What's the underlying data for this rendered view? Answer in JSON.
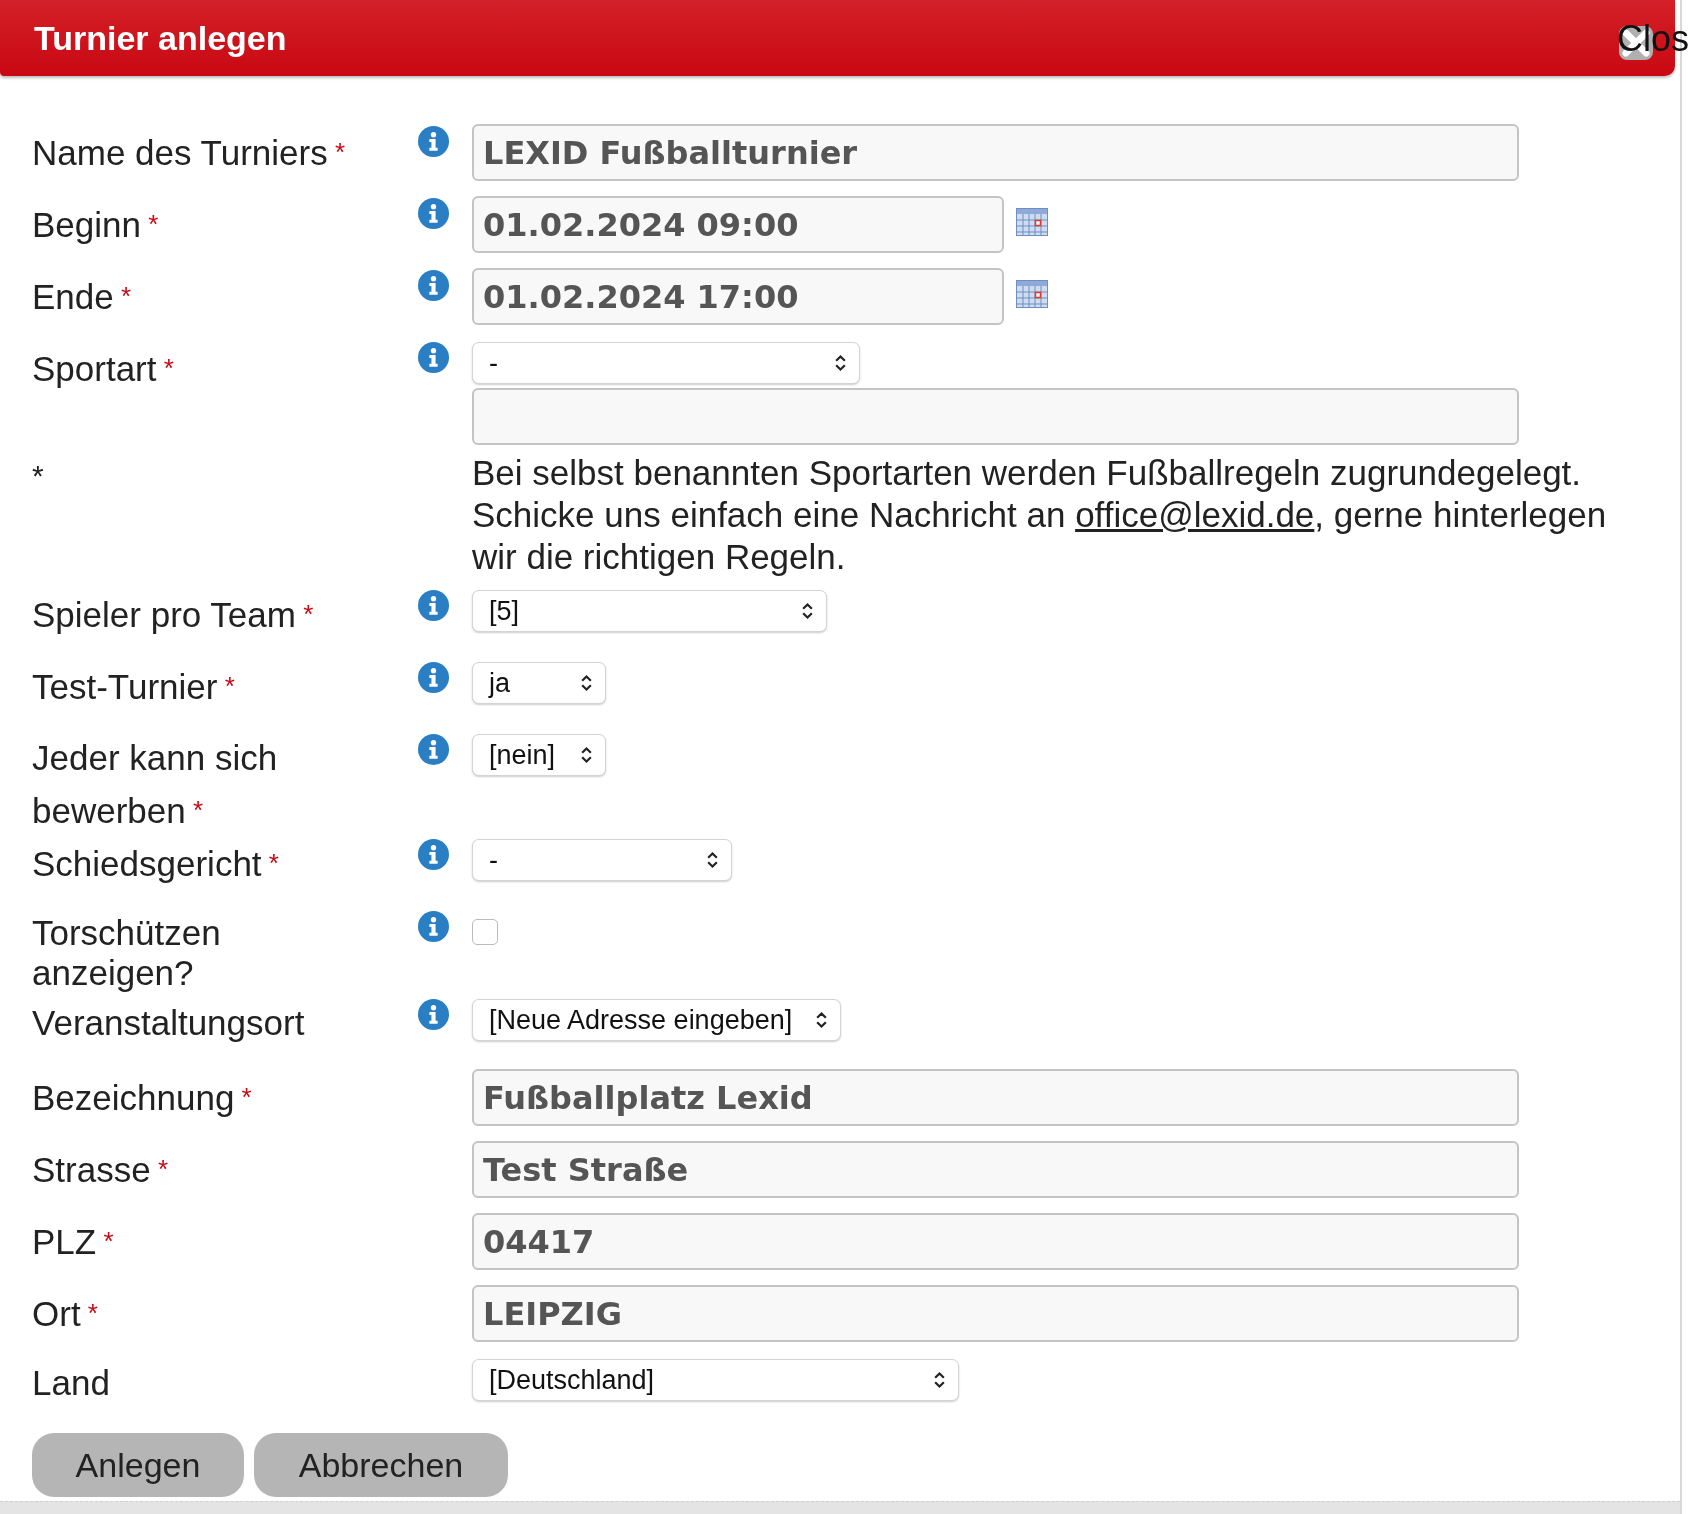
{
  "dialog": {
    "title": "Turnier anlegen",
    "close_button": "Clos"
  },
  "fields": [
    {
      "kind": "text",
      "label": "Name des Turniers",
      "required": true,
      "info": true,
      "value": "LEXID Fußballturnier"
    },
    {
      "kind": "date",
      "label": "Beginn",
      "required": true,
      "info": true,
      "value": "01.02.2024 09:00"
    },
    {
      "kind": "date",
      "label": "Ende",
      "required": true,
      "info": true,
      "value": "01.02.2024 17:00"
    },
    {
      "kind": "select_input",
      "label": "Sportart",
      "required": true,
      "info": true,
      "value": "-"
    },
    {
      "kind": "note",
      "label": "*",
      "required": false,
      "info": false,
      "text_before": "Bei selbst benannten Sportarten werden Fußballregeln zugrundegelegt. Schicke uns einfach eine Nachricht an ",
      "link": "office@lexid.de",
      "text_after": ", gerne hinterlegen wir die richtigen Regeln."
    },
    {
      "kind": "select",
      "label": "Spieler pro Team",
      "required": true,
      "info": true,
      "value": "[5]"
    },
    {
      "kind": "select",
      "label": "Test-Turnier",
      "required": true,
      "info": true,
      "value": "ja"
    },
    {
      "kind": "select",
      "label": "Jeder kann sich bewerben",
      "required": true,
      "info": true,
      "value": "[nein]"
    },
    {
      "kind": "select",
      "label": "Schiedsgericht",
      "required": true,
      "info": true,
      "value": "-"
    },
    {
      "kind": "checkbox",
      "label": "Torschützen anzeigen?",
      "required": false,
      "info": true,
      "checked": false
    },
    {
      "kind": "select",
      "label": "Veranstaltungsort",
      "required": false,
      "info": true,
      "value": "[Neue Adresse eingeben]"
    },
    {
      "kind": "text",
      "label": "Bezeichnung",
      "required": true,
      "info": false,
      "value": "Fußballplatz Lexid"
    },
    {
      "kind": "text",
      "label": "Strasse",
      "required": true,
      "info": false,
      "value": "Test Straße"
    },
    {
      "kind": "text",
      "label": "PLZ",
      "required": true,
      "info": false,
      "value": "04417"
    },
    {
      "kind": "text",
      "label": "Ort",
      "required": true,
      "info": false,
      "value": "LEIPZIG"
    },
    {
      "kind": "select",
      "label": "Land",
      "required": false,
      "info": false,
      "value": "[Deutschland]"
    }
  ],
  "buttons": [
    "Anlegen",
    "Abbrechen"
  ]
}
